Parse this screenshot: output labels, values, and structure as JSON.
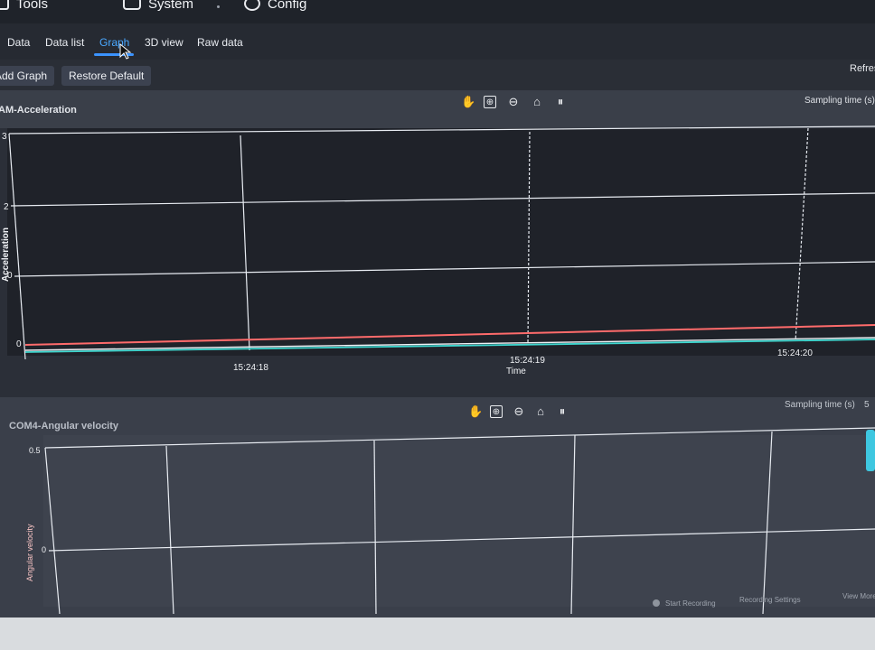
{
  "menu": {
    "tools_label": "Tools",
    "system_label": "System",
    "config_label": "Config"
  },
  "tabs": [
    {
      "label": "Data"
    },
    {
      "label": "Data list"
    },
    {
      "label": "Graph",
      "active": true
    },
    {
      "label": "3D view"
    },
    {
      "label": "Raw data"
    }
  ],
  "toolbar": {
    "add_graph_label": "Add Graph",
    "restore_default_label": "Restore Default",
    "refresh_label": "Refresh"
  },
  "graph1": {
    "title": "AM-Acceleration",
    "sampling_label": "Sampling time (s)",
    "y_label": "Acceleration",
    "x_label": "Time",
    "y_ticks": [
      "3",
      "2",
      "0",
      "0"
    ],
    "x_ticks": [
      "15:24:18",
      "15:24:19",
      "15:24:20"
    ],
    "series_colors": [
      "#ff6b6b",
      "#3fd8d0"
    ]
  },
  "graph2": {
    "title": "COM4-Angular velocity",
    "sampling_label": "Sampling time (s)",
    "sampling_value": "5",
    "y_label": "Angular velocity",
    "y_ticks": [
      "0.5",
      "0"
    ]
  },
  "statusbar": {
    "start_recording": "Start Recording",
    "recording_settings": "Recording Settings",
    "view_more": "View More"
  },
  "colors": {
    "accent": "#3b93ff",
    "grid": "#e8ecf2"
  }
}
